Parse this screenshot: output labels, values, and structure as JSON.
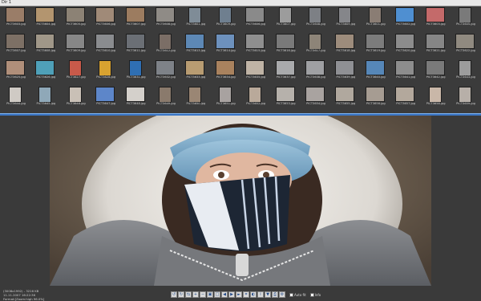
{
  "window": {
    "title": "Dir 1"
  },
  "thumbnails": [
    {
      "file": "PICT3603.jpg",
      "c": "#9a7d68",
      "p": "w"
    },
    {
      "file": "PICT3604.jpg",
      "c": "#b3956f",
      "p": "w"
    },
    {
      "file": "PICT3605.jpg",
      "c": "#8c8275",
      "p": "w"
    },
    {
      "file": "PICT3606.jpg",
      "c": "#a08a78",
      "p": "w"
    },
    {
      "file": "PICT3607.jpg",
      "c": "#9c7c60",
      "p": "w"
    },
    {
      "file": "PICT3608.jpg",
      "c": "#8f8b86",
      "p": "w"
    },
    {
      "file": "PICT3601.jpg",
      "c": "#7f8c97",
      "p": "t"
    },
    {
      "file": "PICT3609.jpg",
      "c": "#6f7f8f",
      "p": "t"
    },
    {
      "file": "PICT3606.jpg",
      "c": "#8a8a8a",
      "p": "w"
    },
    {
      "file": "PICT3607.jpg",
      "c": "#9c9c9c",
      "p": "t"
    },
    {
      "file": "PICT3608.jpg",
      "c": "#7d8085",
      "p": "t"
    },
    {
      "file": "PICT3609.jpg",
      "c": "#85868a",
      "p": "t"
    },
    {
      "file": "PICT3601.jpg",
      "c": "#8a7d74",
      "p": "t"
    },
    {
      "file": "PICT3602.jpg",
      "c": "#4f8fd1",
      "p": "w"
    },
    {
      "file": "PICT3603.jpg",
      "c": "#c46a6a",
      "p": "w"
    },
    {
      "file": "PICT3605.jpg",
      "c": "#7a7a7a",
      "p": "t"
    },
    {
      "file": "PICT3607.jpg",
      "c": "#7d7065",
      "p": "w"
    },
    {
      "file": "PICT3608.jpg",
      "c": "#a09788",
      "p": "w"
    },
    {
      "file": "PICT3609.jpg",
      "c": "#878787",
      "p": "w"
    },
    {
      "file": "PICT3610.jpg",
      "c": "#8a8c8f",
      "p": "w"
    },
    {
      "file": "PICT3611.jpg",
      "c": "#6b6f75",
      "p": "w"
    },
    {
      "file": "PICT3612.jpg",
      "c": "#7b6e66",
      "p": "t"
    },
    {
      "file": "PICT3613.jpg",
      "c": "#5d88b5",
      "p": "w"
    },
    {
      "file": "PICT3614.jpg",
      "c": "#6d91bd",
      "p": "w"
    },
    {
      "file": "PICT3615.jpg",
      "c": "#8f8f8f",
      "p": "w"
    },
    {
      "file": "PICT3616.jpg",
      "c": "#7a7a7a",
      "p": "w"
    },
    {
      "file": "PICT3617.jpg",
      "c": "#8d8478",
      "p": "t"
    },
    {
      "file": "PICT3618.jpg",
      "c": "#9d8c7c",
      "p": "w"
    },
    {
      "file": "PICT3619.jpg",
      "c": "#7c7c7c",
      "p": "w"
    },
    {
      "file": "PICT3620.jpg",
      "c": "#8c8c8c",
      "p": "w"
    },
    {
      "file": "PICT3621.jpg",
      "c": "#868686",
      "p": "w"
    },
    {
      "file": "PICT3622.jpg",
      "c": "#908a80",
      "p": "w"
    },
    {
      "file": "PICT3625.jpg",
      "c": "#b08f7a",
      "p": "w"
    },
    {
      "file": "PICT3626.jpg",
      "c": "#4fa0b8",
      "p": "w"
    },
    {
      "file": "PICT3627.jpg",
      "c": "#c85a4a",
      "p": "t"
    },
    {
      "file": "PICT3628.jpg",
      "c": "#d8a230",
      "p": "t"
    },
    {
      "file": "PICT3631.jpg",
      "c": "#2f6fb3",
      "p": "t"
    },
    {
      "file": "PICT3632.jpg",
      "c": "#7e8288",
      "p": "w"
    },
    {
      "file": "PICT3633.jpg",
      "c": "#b89c72",
      "p": "w"
    },
    {
      "file": "PICT3634.jpg",
      "c": "#a9825e",
      "p": "w"
    },
    {
      "file": "PICT3635.jpg",
      "c": "#bfb3a5",
      "p": "w"
    },
    {
      "file": "PICT3637.jpg",
      "c": "#a9aaac",
      "p": "w"
    },
    {
      "file": "PICT3638.jpg",
      "c": "#9fa0a3",
      "p": "w"
    },
    {
      "file": "PICT3639.jpg",
      "c": "#8f9094",
      "p": "w"
    },
    {
      "file": "PICT3640.jpg",
      "c": "#5687b8",
      "p": "w"
    },
    {
      "file": "PICT3641.jpg",
      "c": "#8d8d8d",
      "p": "w"
    },
    {
      "file": "PICT3642.jpg",
      "c": "#7a7a7a",
      "p": "w"
    },
    {
      "file": "PICT3643.jpg",
      "c": "#9c9c9c",
      "p": "t"
    },
    {
      "file": "PICT3644.jpg",
      "c": "#cfcac4",
      "p": "t"
    },
    {
      "file": "PICT3645.jpg",
      "c": "#8fa8b8",
      "p": "t"
    },
    {
      "file": "PICT3646.jpg",
      "c": "#c9c0b6",
      "p": "t"
    },
    {
      "file": "PICT3647.jpg",
      "c": "#5d86c9",
      "p": "w"
    },
    {
      "file": "PICT3648.jpg",
      "c": "#d4d0cb",
      "p": "w"
    },
    {
      "file": "PICT3649.jpg",
      "c": "#8a7a6c",
      "p": "t"
    },
    {
      "file": "PICT3650.jpg",
      "c": "#9a8674",
      "p": "t"
    },
    {
      "file": "PICT3651.jpg",
      "c": "#a8a2a0",
      "p": "t"
    },
    {
      "file": "PICT3652.jpg",
      "c": "#b9a99a",
      "p": "t"
    },
    {
      "file": "PICT3653.jpg",
      "c": "#b6b1ab",
      "p": "w"
    },
    {
      "file": "PICT3654.jpg",
      "c": "#a9a3a0",
      "p": "w"
    },
    {
      "file": "PICT3655.jpg",
      "c": "#b0a89e",
      "p": "w"
    },
    {
      "file": "PICT3656.jpg",
      "c": "#a69c92",
      "p": "w"
    },
    {
      "file": "PICT3657.jpg",
      "c": "#b3a89c",
      "p": "w"
    },
    {
      "file": "PICT3658.jpg",
      "c": "#c9b7a8",
      "p": "t"
    },
    {
      "file": "PICT3659.jpg",
      "c": "#b7afa8",
      "p": "t"
    }
  ],
  "viewer": {
    "info_line1": "(3008x1992) - 3216 KB",
    "info_line2": "11.11.2007 16:22:36",
    "info_line3": "Format:[Zoom:high 96.0%]"
  },
  "toolbar": {
    "buttons": [
      {
        "icon": "rotate-left-icon",
        "glyph": "↺"
      },
      {
        "icon": "rotate-right-icon",
        "glyph": "↻"
      },
      {
        "icon": "flip-icon",
        "glyph": "⇆"
      },
      {
        "icon": "zoom-in-icon",
        "glyph": "+"
      },
      {
        "icon": "zoom-out-icon",
        "glyph": "−"
      },
      {
        "icon": "fit-icon",
        "glyph": "▣"
      },
      {
        "icon": "actual-size-icon",
        "glyph": "□"
      },
      {
        "icon": "prev-icon",
        "glyph": "◀"
      },
      {
        "icon": "next-icon",
        "glyph": "▶"
      },
      {
        "icon": "slideshow-icon",
        "glyph": "►"
      },
      {
        "icon": "crop-icon",
        "glyph": "⌗"
      },
      {
        "icon": "adjust-icon",
        "glyph": "◐"
      },
      {
        "icon": "info-icon",
        "glyph": "i"
      },
      {
        "icon": "save-icon",
        "glyph": "▼"
      },
      {
        "icon": "print-icon",
        "glyph": "⎙"
      },
      {
        "icon": "settings-icon",
        "glyph": "⚙"
      }
    ],
    "check1_label": "Auto fit",
    "check2_label": "Info"
  }
}
